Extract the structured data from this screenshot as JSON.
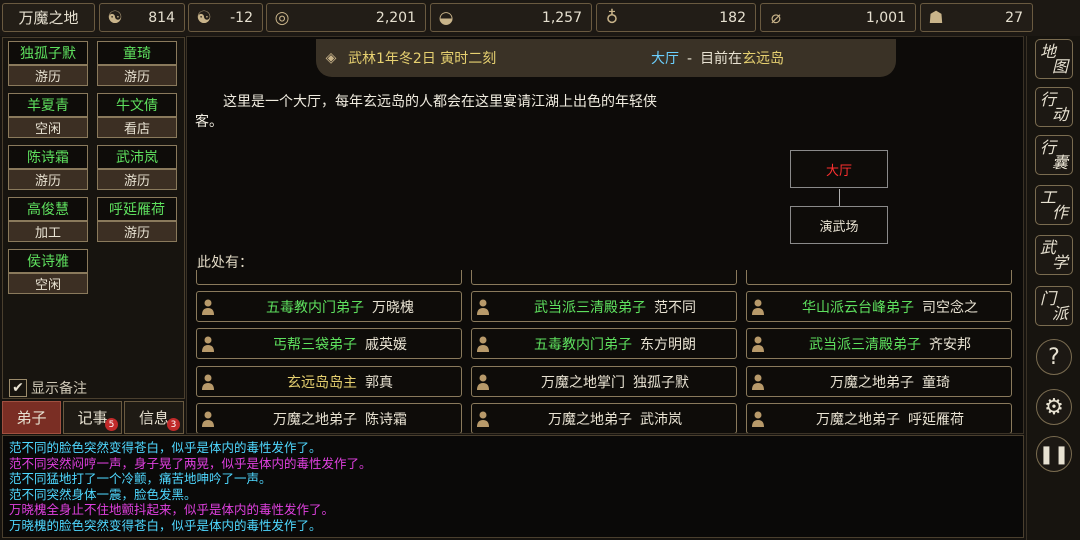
{
  "location_title": "万魔之地",
  "resources": [
    {
      "icon": "yin-yang-icon",
      "value": "814"
    },
    {
      "icon": "taiji-icon",
      "value": "-12"
    },
    {
      "icon": "coin-icon",
      "value": "2,201"
    },
    {
      "icon": "rice-bowl-icon",
      "value": "1,257"
    },
    {
      "icon": "gourd-icon",
      "value": "182"
    },
    {
      "icon": "wood-log-icon",
      "value": "1,001"
    },
    {
      "icon": "ore-icon",
      "value": "27"
    }
  ],
  "disciples": [
    {
      "name": "独孤子默",
      "status": "游历"
    },
    {
      "name": "童琦",
      "status": "游历"
    },
    {
      "name": "羊夏青",
      "status": "空闲"
    },
    {
      "name": "牛文倩",
      "status": "看店"
    },
    {
      "name": "陈诗霜",
      "status": "游历"
    },
    {
      "name": "武沛岚",
      "status": "游历"
    },
    {
      "name": "高俊慧",
      "status": "加工"
    },
    {
      "name": "呼延雁荷",
      "status": "游历"
    },
    {
      "name": "侯诗雅",
      "status": "空闲"
    }
  ],
  "show_note_label": "显示备注",
  "left_tabs": [
    {
      "label": "弟子",
      "badge": ""
    },
    {
      "label": "记事",
      "badge": "5"
    },
    {
      "label": "信息",
      "badge": "3"
    }
  ],
  "header": {
    "date": "武林1年冬2日 寅时二刻",
    "room": "大厅",
    "separator": "-",
    "prefix": "目前在",
    "island": "玄远岛"
  },
  "description": "这里是一个大厅，每年玄远岛的人都会在这里宴请江湖上出色的年轻侠客。",
  "map": {
    "current": "大厅",
    "south": "演武场"
  },
  "here_label": "此处有：",
  "npcs": [
    {
      "title": "五毒教内门弟子",
      "name": "万晓槐",
      "color": "#5ee05e"
    },
    {
      "title": "武当派三清殿弟子",
      "name": "范不同",
      "color": "#5ee05e"
    },
    {
      "title": "华山派云台峰弟子",
      "name": "司空念之",
      "color": "#5ee05e"
    },
    {
      "title": "丐帮三袋弟子",
      "name": "戚英媛",
      "color": "#5ee05e"
    },
    {
      "title": "五毒教内门弟子",
      "name": "东方明朗",
      "color": "#5ee05e"
    },
    {
      "title": "武当派三清殿弟子",
      "name": "齐安邦",
      "color": "#5ee05e"
    },
    {
      "title": "玄远岛岛主",
      "name": "郭真",
      "color": "#e6d070"
    },
    {
      "title": "万魔之地掌门",
      "name": "独孤子默",
      "color": "#e8e2d2"
    },
    {
      "title": "万魔之地弟子",
      "name": "童琦",
      "color": "#e8e2d2"
    },
    {
      "title": "万魔之地弟子",
      "name": "陈诗霜",
      "color": "#e8e2d2"
    },
    {
      "title": "万魔之地弟子",
      "name": "武沛岚",
      "color": "#e8e2d2"
    },
    {
      "title": "万魔之地弟子",
      "name": "呼延雁荷",
      "color": "#e8e2d2"
    }
  ],
  "log": [
    {
      "text": "范不同的脸色突然变得苍白，似乎是体内的毒性发作了。",
      "color": "#4fd8ff"
    },
    {
      "text": "范不同突然闷哼一声，身子晃了两晃，似乎是体内的毒性发作了。",
      "color": "#e040e0"
    },
    {
      "text": "范不同猛地打了一个冷颤，痛苦地呻吟了一声。",
      "color": "#4fd8ff"
    },
    {
      "text": "范不同突然身体一震，脸色发黑。",
      "color": "#4fd8ff"
    },
    {
      "text": "万晓槐全身止不住地颤抖起来，似乎是体内的毒性发作了。",
      "color": "#e040e0"
    },
    {
      "text": "万晓槐的脸色突然变得苍白，似乎是体内的毒性发作了。",
      "color": "#4fd8ff"
    }
  ],
  "right_menu": [
    {
      "label": "地图",
      "icon": "map-icon"
    },
    {
      "label": "行动",
      "icon": "action-icon"
    },
    {
      "label": "行囊",
      "icon": "bag-icon"
    },
    {
      "label": "工作",
      "icon": "work-icon"
    },
    {
      "label": "武学",
      "icon": "martial-icon"
    },
    {
      "label": "门派",
      "icon": "sect-icon"
    }
  ]
}
